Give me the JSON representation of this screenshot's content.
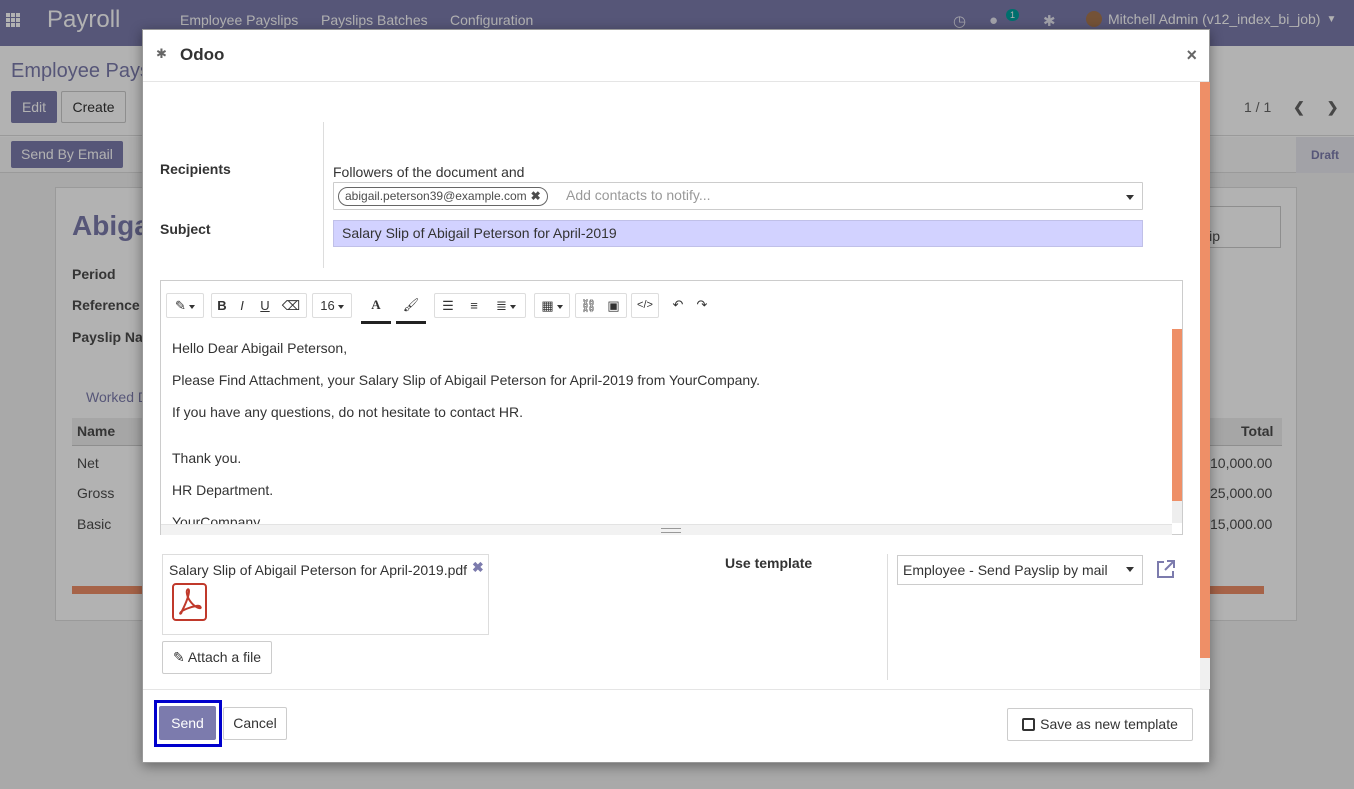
{
  "navbar": {
    "brand": "Payroll",
    "menu": [
      "Employee Payslips",
      "Payslips Batches",
      "Configuration"
    ],
    "chat_count": "1",
    "user": "Mitchell Admin (v12_index_bi_job)"
  },
  "control_panel": {
    "breadcrumb": "Employee Pays",
    "edit_label": "Edit",
    "create_label": "Create",
    "pager": "1 / 1"
  },
  "statusbar": {
    "send_by_email": "Send By Email",
    "state": "Draft"
  },
  "sheet": {
    "name": "Abiga",
    "fields": [
      "Period",
      "Reference",
      "Payslip Na"
    ],
    "tab": "Worked D",
    "table_headers": {
      "name": "Name",
      "total": "Total"
    },
    "rows": [
      {
        "name": "Net",
        "total": "10,000.00"
      },
      {
        "name": "Gross",
        "total": "25,000.00"
      },
      {
        "name": "Basic",
        "total": "15,000.00"
      }
    ],
    "right_box": "lip"
  },
  "modal": {
    "title": "Odoo",
    "recipients_label": "Recipients",
    "followers_text": "Followers of the document and",
    "recipient_tag": "abigail.peterson39@example.com",
    "recipients_placeholder": "Add contacts to notify...",
    "subject_label": "Subject",
    "subject_value": "Salary Slip of Abigail Peterson for April-2019",
    "toolbar": {
      "font_size": "16"
    },
    "body_lines": [
      "Hello Dear Abigail Peterson,",
      "Please Find Attachment, your Salary Slip of Abigail Peterson for April-2019 from YourCompany.",
      "If you have any questions, do not hesitate to contact HR.",
      "Thank you.",
      "HR Department.",
      "YourCompany"
    ],
    "attachment_name": "Salary Slip of Abigail Peterson for April-2019.pdf",
    "attach_file_label": "Attach a file",
    "use_template_label": "Use template",
    "template_value": "Employee - Send Payslip by mail",
    "send_label": "Send",
    "cancel_label": "Cancel",
    "save_template_label": "Save as new template"
  },
  "colors": {
    "brand": "#7c7bad",
    "accent_scroll": "#ee8f67",
    "subject_bg": "#d2d2ff",
    "focus_outline": "#0000cc"
  }
}
